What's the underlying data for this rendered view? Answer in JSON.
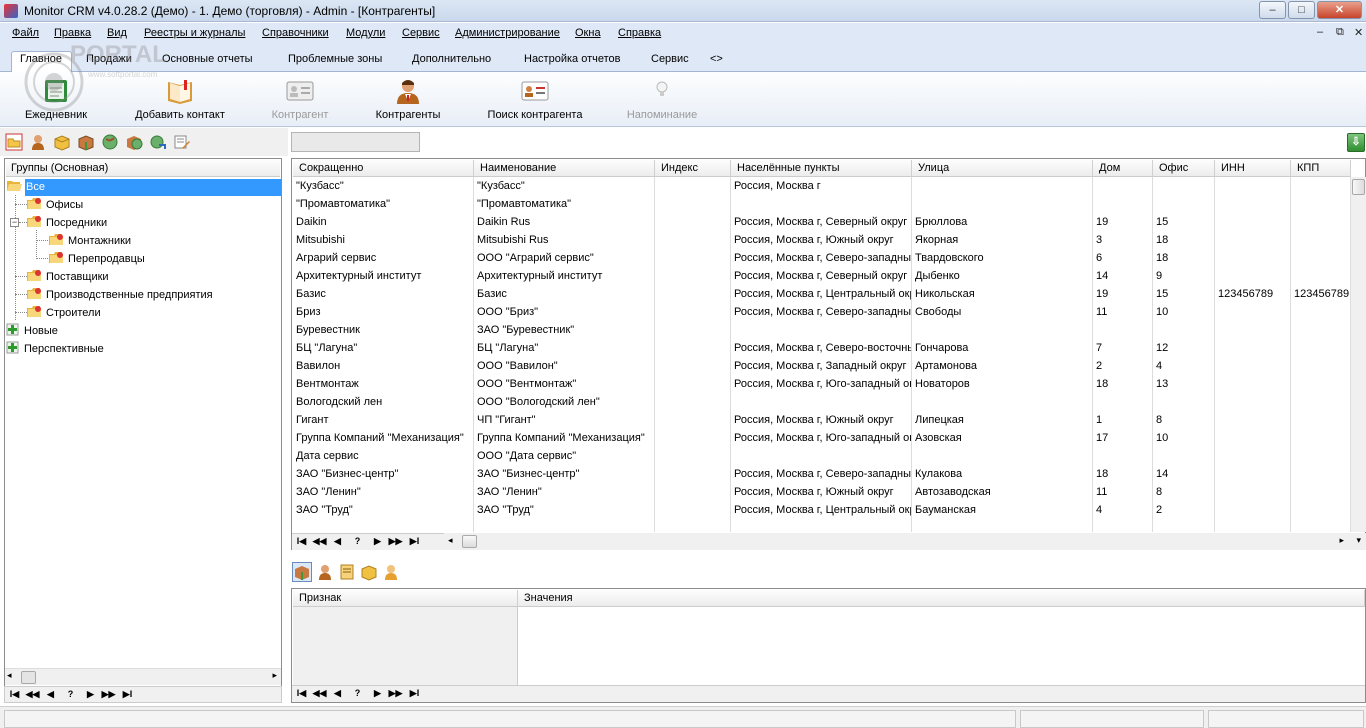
{
  "window": {
    "title": "Monitor CRM v4.0.28.2 (Демо) - 1. Демо (торговля) - Admin - [Контрагенты]",
    "controls": {
      "minimize": "–",
      "maximize": "□",
      "close": "✕"
    }
  },
  "menu": {
    "items": [
      "Файл",
      "Правка",
      "Вид",
      "Реестры и журналы",
      "Справочники",
      "Модули",
      "Сервис",
      "Администрирование",
      "Окна",
      "Справка"
    ],
    "mdi_controls": {
      "minimize": "–",
      "restore": "⧉",
      "close": "✕"
    }
  },
  "ribbon": {
    "tabs": [
      "Главное",
      "Продажи",
      "Основные отчеты",
      "Проблемные зоны",
      "Дополнительно",
      "Настройка отчетов",
      "Сервис",
      "<>"
    ],
    "active_tab": "Главное",
    "buttons": [
      {
        "label": "Ежедневник",
        "icon": "diary-icon",
        "enabled": true
      },
      {
        "label": "Добавить контакт",
        "icon": "add-contact-book-icon",
        "enabled": true
      },
      {
        "label": "Контрагент",
        "icon": "contact-card-icon",
        "enabled": false
      },
      {
        "label": "Контрагенты",
        "icon": "person-icon",
        "enabled": true
      },
      {
        "label": "Поиск контрагента",
        "icon": "search-contact-card-icon",
        "enabled": true
      },
      {
        "label": "Напоминание",
        "icon": "lightbulb-icon",
        "enabled": false
      }
    ]
  },
  "watermark": {
    "text": "PORTAL",
    "url": "www.softportal.com"
  },
  "search": {
    "value": ""
  },
  "groups": {
    "header": "Группы (Основная)",
    "items": [
      "Все",
      "Офисы",
      "Посредники",
      "Монтажники",
      "Перепродавцы",
      "Поставщики",
      "Производственные предприятия",
      "Строители",
      "Новые",
      "Перспективные"
    ],
    "selected": "Все"
  },
  "navigator": {
    "buttons": [
      "I◀",
      "◀◀",
      "◀",
      "?",
      "▶",
      "▶▶",
      "▶I"
    ]
  },
  "grid": {
    "columns": [
      "Сокращенно",
      "Наименование",
      "Индекс",
      "Населённые пункты",
      "Улица",
      "Дом",
      "Офис",
      "ИНН",
      "КПП"
    ],
    "rows": [
      [
        "\"Кузбасс\"",
        "\"Кузбасс\"",
        "",
        "Россия, Москва г",
        "",
        "",
        "",
        "",
        ""
      ],
      [
        "\"Промавтоматика\"",
        "\"Промавтоматика\"",
        "",
        "",
        "",
        "",
        "",
        "",
        ""
      ],
      [
        "Daikin",
        "Daikin Rus",
        "",
        "Россия, Москва г, Северный округ",
        "Брюллова",
        "19",
        "15",
        "",
        ""
      ],
      [
        "Mitsubishi",
        "Mitsubishi Rus",
        "",
        "Россия, Москва г, Южный округ",
        "Якорная",
        "3",
        "18",
        "",
        ""
      ],
      [
        "Аграрий сервис",
        "ООО \"Аграрий сервис\"",
        "",
        "Россия, Москва г, Северо-западный",
        "Твардовского",
        "6",
        "18",
        "",
        ""
      ],
      [
        "Архитектурный институт",
        "Архитектурный институт",
        "",
        "Россия, Москва г, Северный округ",
        "Дыбенко",
        "14",
        "9",
        "",
        ""
      ],
      [
        "Базис",
        "Базис",
        "",
        "Россия, Москва г, Центральный округ",
        "Никольская",
        "19",
        "15",
        "123456789",
        "123456789"
      ],
      [
        "Бриз",
        "ООО \"Бриз\"",
        "",
        "Россия, Москва г, Северо-западный",
        "Свободы",
        "11",
        "10",
        "",
        ""
      ],
      [
        "Буревестник",
        "ЗАО \"Буревестник\"",
        "",
        "",
        "",
        "",
        "",
        "",
        ""
      ],
      [
        "БЦ \"Лагуна\"",
        "БЦ \"Лагуна\"",
        "",
        "Россия, Москва г, Северо-восточный",
        "Гончарова",
        "7",
        "12",
        "",
        ""
      ],
      [
        "Вавилон",
        "ООО \"Вавилон\"",
        "",
        "Россия, Москва г, Западный округ",
        "Артамонова",
        "2",
        "4",
        "",
        ""
      ],
      [
        "Вентмонтаж",
        "ООО \"Вентмонтаж\"",
        "",
        "Россия, Москва г, Юго-западный округ",
        "Новаторов",
        "18",
        "13",
        "",
        ""
      ],
      [
        "Вологодский лен",
        "ООО \"Вологодский лен\"",
        "",
        "",
        "",
        "",
        "",
        "",
        ""
      ],
      [
        "Гигант",
        "ЧП \"Гигант\"",
        "",
        "Россия, Москва г, Южный округ",
        "Липецкая",
        "1",
        "8",
        "",
        ""
      ],
      [
        "Группа Компаний \"Механизация\"",
        "Группа Компаний \"Механизация\"",
        "",
        "Россия, Москва г, Юго-западный округ",
        "Азовская",
        "17",
        "10",
        "",
        ""
      ],
      [
        "Дата сервис",
        "ООО \"Дата сервис\"",
        "",
        "",
        "",
        "",
        "",
        "",
        ""
      ],
      [
        "ЗАО \"Бизнес-центр\"",
        "ЗАО \"Бизнес-центр\"",
        "",
        "Россия, Москва г, Северо-западный",
        "Кулакова",
        "18",
        "14",
        "",
        ""
      ],
      [
        "ЗАО \"Ленин\"",
        "ЗАО \"Ленин\"",
        "",
        "Россия, Москва г, Южный округ",
        "Автозаводская",
        "11",
        "8",
        "",
        ""
      ],
      [
        "ЗАО \"Труд\"",
        "ЗАО \"Труд\"",
        "",
        "Россия, Москва г, Центральный округ",
        "Бауманская",
        "4",
        "2",
        "",
        ""
      ]
    ]
  },
  "details": {
    "columns": [
      "Признак",
      "Значения"
    ]
  },
  "colors": {
    "selection": "#3399ff",
    "ribbon_bg": "#dfe8f6",
    "folder": "#f3c64a"
  }
}
